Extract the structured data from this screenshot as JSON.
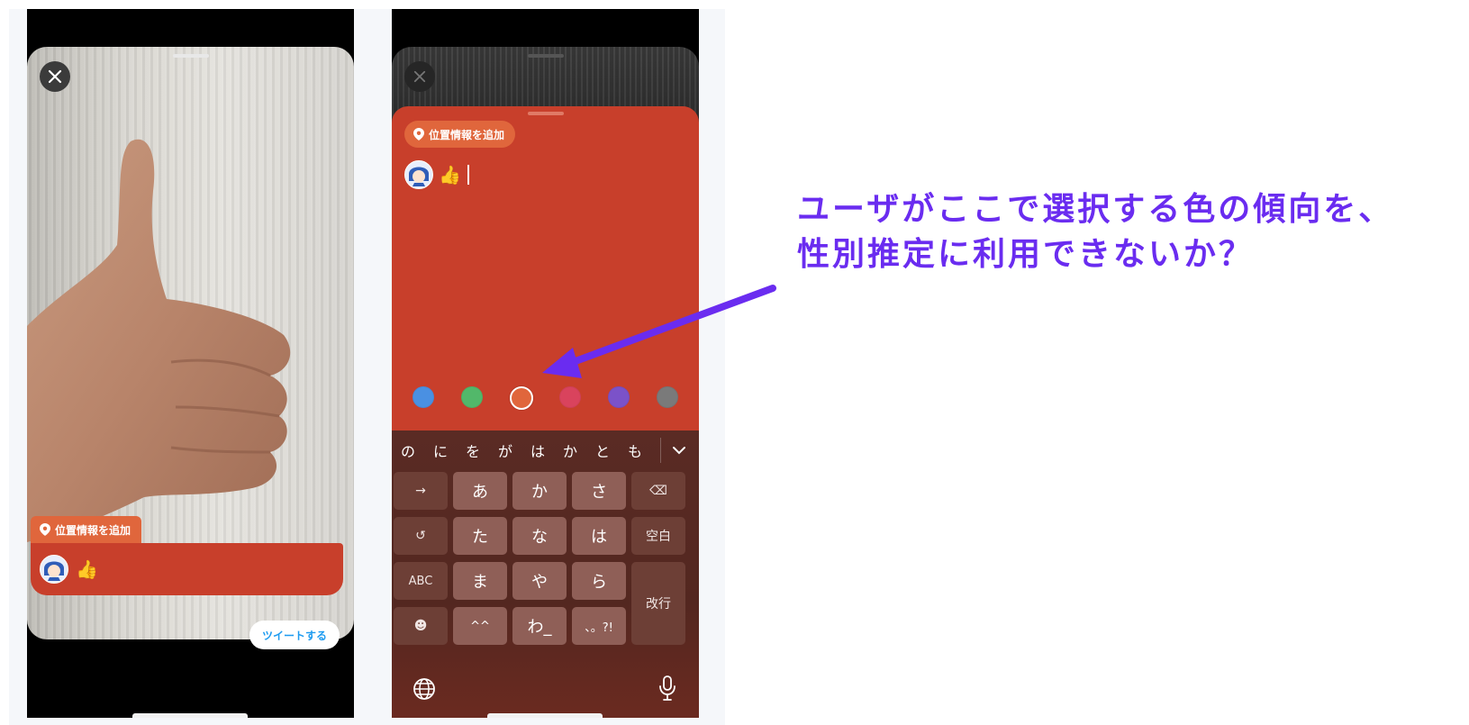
{
  "phone_left": {
    "location_label": "位置情報を追加",
    "compose_text": "👍",
    "tweet_button": "ツイートする"
  },
  "phone_right": {
    "location_label": "位置情報を追加",
    "compose_text": "👍",
    "color_options": [
      {
        "name": "blue",
        "hex": "#4a90e2",
        "selected": false
      },
      {
        "name": "green",
        "hex": "#52b86a",
        "selected": false
      },
      {
        "name": "orange",
        "hex": "#e0663c",
        "selected": true
      },
      {
        "name": "pink",
        "hex": "#d9435d",
        "selected": false
      },
      {
        "name": "purple",
        "hex": "#7b52c9",
        "selected": false
      },
      {
        "name": "gray",
        "hex": "#7a7a7a",
        "selected": false
      }
    ],
    "keyboard": {
      "candidates": [
        "の",
        "に",
        "を",
        "が",
        "は",
        "か",
        "と",
        "も"
      ],
      "row1": [
        "→",
        "あ",
        "か",
        "さ",
        "⌫"
      ],
      "row2": [
        "↺",
        "た",
        "な",
        "は",
        "空白"
      ],
      "row3": [
        "ABC",
        "ま",
        "や",
        "ら"
      ],
      "row4": [
        "☻",
        "^^",
        "わ_",
        "、。?!"
      ],
      "enter_label": "改行"
    }
  },
  "annotation": {
    "line1": "ユーザがここで選択する色の傾向を、",
    "line2": "性別推定に利用できないか？",
    "color": "#6a2cf0"
  }
}
